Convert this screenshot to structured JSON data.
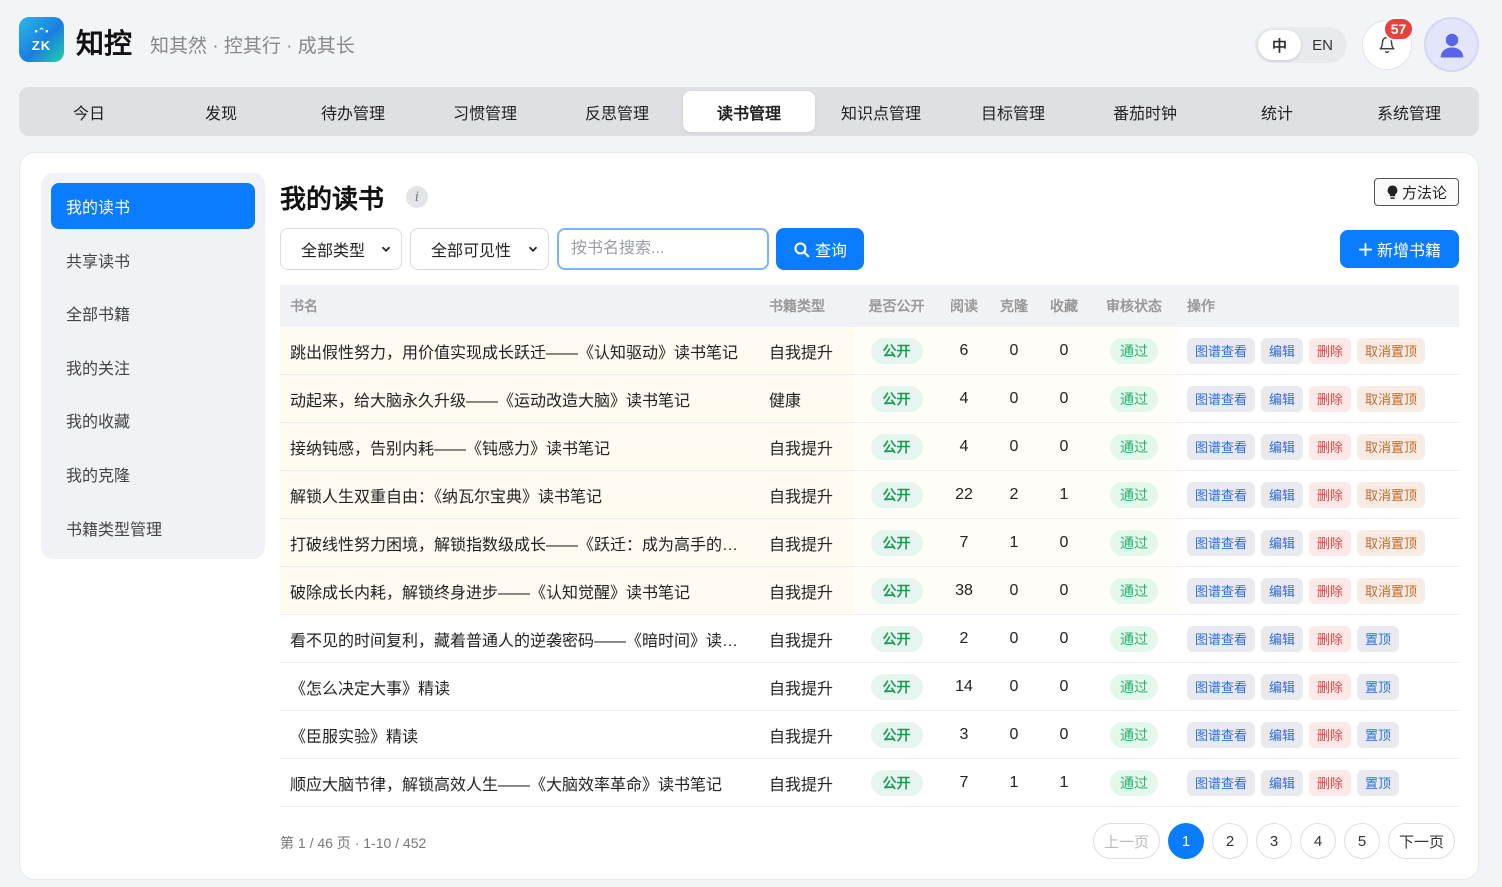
{
  "app": {
    "logo_text": "ZK",
    "name": "知控",
    "slogan": "知其然 · 控其行 · 成其长"
  },
  "lang": {
    "zh": "中",
    "en": "EN"
  },
  "notifications": {
    "count": "57"
  },
  "nav": [
    {
      "label": "今日",
      "active": false
    },
    {
      "label": "发现",
      "active": false
    },
    {
      "label": "待办管理",
      "active": false
    },
    {
      "label": "习惯管理",
      "active": false
    },
    {
      "label": "反思管理",
      "active": false
    },
    {
      "label": "读书管理",
      "active": true
    },
    {
      "label": "知识点管理",
      "active": false
    },
    {
      "label": "目标管理",
      "active": false
    },
    {
      "label": "番茄时钟",
      "active": false
    },
    {
      "label": "统计",
      "active": false
    },
    {
      "label": "系统管理",
      "active": false
    }
  ],
  "sidebar": [
    {
      "label": "我的读书",
      "active": true
    },
    {
      "label": "共享读书",
      "active": false
    },
    {
      "label": "全部书籍",
      "active": false
    },
    {
      "label": "我的关注",
      "active": false
    },
    {
      "label": "我的收藏",
      "active": false
    },
    {
      "label": "我的克隆",
      "active": false
    },
    {
      "label": "书籍类型管理",
      "active": false
    }
  ],
  "page": {
    "title": "我的读书",
    "info": "i",
    "method_label": "方法论"
  },
  "filters": {
    "type_select": "全部类型",
    "visibility_select": "全部可见性",
    "search_placeholder": "按书名搜索...",
    "query_label": "查询",
    "add_label": "新增书籍"
  },
  "table": {
    "headers": {
      "name": "书名",
      "type": "书籍类型",
      "public": "是否公开",
      "read": "阅读",
      "clone": "克隆",
      "fav": "收藏",
      "status": "审核状态",
      "ops": "操作"
    },
    "op_labels": {
      "graph": "图谱查看",
      "edit": "编辑",
      "delete": "删除",
      "unpin": "取消置顶",
      "pin": "置顶"
    },
    "rows": [
      {
        "name": "跳出假性努力，用价值实现成长跃迁——《认知驱动》读书笔记",
        "type": "自我提升",
        "public": "公开",
        "read": "6",
        "clone": "0",
        "fav": "0",
        "status": "通过",
        "pinned": true
      },
      {
        "name": "动起来，给大脑永久升级——《运动改造大脑》读书笔记",
        "type": "健康",
        "public": "公开",
        "read": "4",
        "clone": "0",
        "fav": "0",
        "status": "通过",
        "pinned": true
      },
      {
        "name": "接纳钝感，告别内耗——《钝感力》读书笔记",
        "type": "自我提升",
        "public": "公开",
        "read": "4",
        "clone": "0",
        "fav": "0",
        "status": "通过",
        "pinned": true
      },
      {
        "name": "解锁人生双重自由：《纳瓦尔宝典》读书笔记",
        "type": "自我提升",
        "public": "公开",
        "read": "22",
        "clone": "2",
        "fav": "1",
        "status": "通过",
        "pinned": true
      },
      {
        "name": "打破线性努力困境，解锁指数级成长——《跃迁：成为高手的技...",
        "type": "自我提升",
        "public": "公开",
        "read": "7",
        "clone": "1",
        "fav": "0",
        "status": "通过",
        "pinned": true
      },
      {
        "name": "破除成长内耗，解锁终身进步——《认知觉醒》读书笔记",
        "type": "自我提升",
        "public": "公开",
        "read": "38",
        "clone": "0",
        "fav": "0",
        "status": "通过",
        "pinned": true
      },
      {
        "name": "看不见的时间复利，藏着普通人的逆袭密码——《暗时间》读书...",
        "type": "自我提升",
        "public": "公开",
        "read": "2",
        "clone": "0",
        "fav": "0",
        "status": "通过",
        "pinned": false
      },
      {
        "name": "《怎么决定大事》精读",
        "type": "自我提升",
        "public": "公开",
        "read": "14",
        "clone": "0",
        "fav": "0",
        "status": "通过",
        "pinned": false
      },
      {
        "name": "《臣服实验》精读",
        "type": "自我提升",
        "public": "公开",
        "read": "3",
        "clone": "0",
        "fav": "0",
        "status": "通过",
        "pinned": false
      },
      {
        "name": "顺应大脑节律，解锁高效人生——《大脑效率革命》读书笔记",
        "type": "自我提升",
        "public": "公开",
        "read": "7",
        "clone": "1",
        "fav": "1",
        "status": "通过",
        "pinned": false
      }
    ]
  },
  "pagination": {
    "info": "第 1 / 46 页 · 1-10 / 452",
    "prev": "上一页",
    "next": "下一页",
    "pages": [
      "1",
      "2",
      "3",
      "4",
      "5"
    ],
    "current": "1"
  },
  "colors": {
    "primary": "#0a7cff",
    "badge": "#e8403a",
    "public_green": "#1d9a5a",
    "delete_red": "#e04848",
    "unpin_orange": "#c46a2c"
  }
}
